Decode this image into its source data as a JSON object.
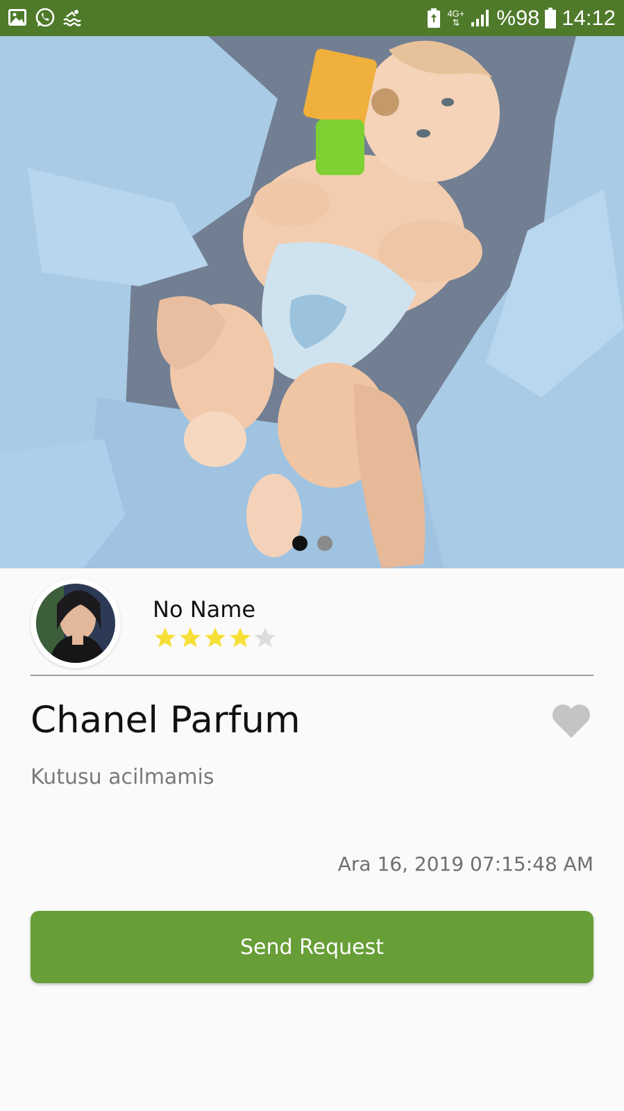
{
  "status_bar": {
    "left_icons": [
      "image-icon",
      "whatsapp-icon",
      "pool-icon"
    ],
    "network_label": "4G+",
    "battery_text": "%98",
    "time": "14:12"
  },
  "gallery": {
    "image_count": 2,
    "active_index": 0
  },
  "seller": {
    "name": "No Name",
    "rating": 4,
    "rating_max": 5
  },
  "product": {
    "title": "Chanel Parfum",
    "description": "Kutusu acilmamis",
    "date": "Ara 16, 2019 07:15:48 AM",
    "favorite": false
  },
  "actions": {
    "send_request_label": "Send Request"
  },
  "colors": {
    "status_bar": "#4e7a2a",
    "primary_button": "#689e37",
    "star_filled": "#f6e038",
    "star_empty": "#dcdcdc",
    "heart": "#c4c4c4"
  }
}
